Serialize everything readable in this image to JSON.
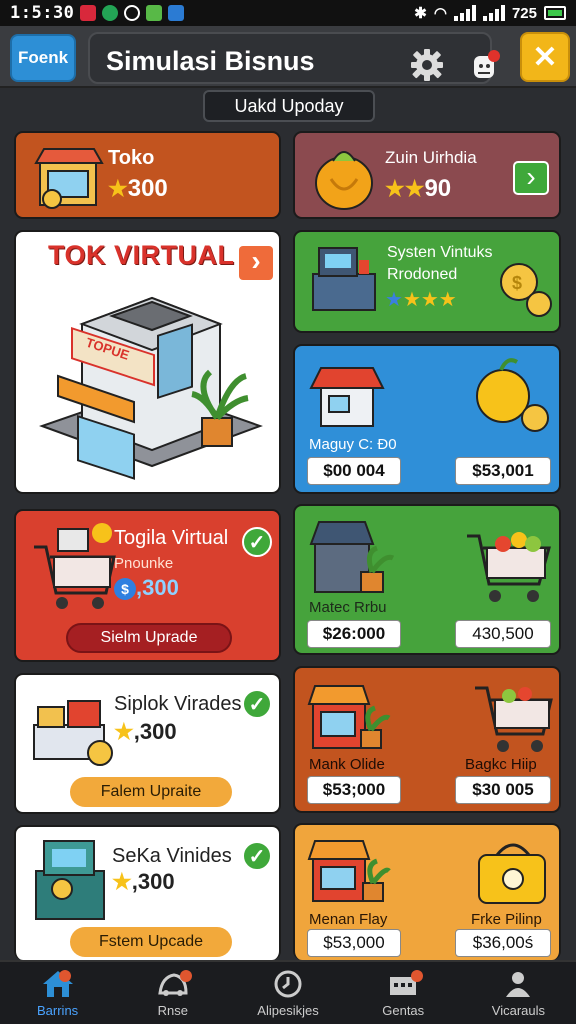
{
  "status": {
    "time": "1:5:30",
    "battery_text": "725"
  },
  "header": {
    "back_label": "Foenk",
    "title": "Simulasi Bisnus",
    "close_label": "✕"
  },
  "update_label": "Uakd Upoday",
  "cards": {
    "toko": {
      "title": "Toko",
      "amount": "300"
    },
    "zuin": {
      "title": "Zuin Uirhdia",
      "amount": "90",
      "arrow": "›"
    },
    "virtual": {
      "title": "TOK VIRTUAL",
      "sign": "TOPUE",
      "arrow": "›"
    },
    "system": {
      "line1": "Systen Vintuks",
      "line2": "Rrodoned"
    },
    "magu": {
      "title": "Maguy C: Đ0",
      "price_left": "$00 004",
      "price_right": "$53,001"
    },
    "togila": {
      "title": "Togila Virtual",
      "subtitle": "Pnounke",
      "amount": ",300",
      "button": "Sielm Uprade"
    },
    "matec": {
      "title": "Matec Rrbu",
      "price_left": "$26:000",
      "price_right": "430,500"
    },
    "siplok": {
      "title": "Siplok Virades",
      "amount": ",300",
      "button": "Falem Upraite"
    },
    "mank": {
      "title_left": "Mank Olide",
      "title_right": "Bagkc Hiip",
      "price_left": "$53;000",
      "price_right": "$30 005"
    },
    "seka": {
      "title": "SeKa Vinides",
      "amount": ",300",
      "button": "Fstem Upcade"
    },
    "menan": {
      "title_left": "Menan Flay",
      "title_right": "Frke Pilinp",
      "price_left": "$53,000",
      "price_right": "$36,00ś"
    }
  },
  "nav": [
    {
      "label": "Barrins"
    },
    {
      "label": "Rnse"
    },
    {
      "label": "Alipesikjes"
    },
    {
      "label": "Gentas"
    },
    {
      "label": "Vicarauls"
    }
  ],
  "colors": {
    "orange_card": "#c2541f",
    "maroon_card": "#8b4a4f",
    "green_card": "#46a33c",
    "blue_card": "#2f8fd8",
    "red_card": "#d9402e",
    "amber_card": "#f0a53c",
    "accent_blue": "#2d8fd6",
    "accent_yellow": "#f2b619"
  }
}
